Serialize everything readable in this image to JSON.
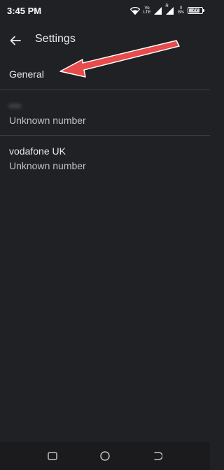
{
  "status_bar": {
    "time": "3:45 PM",
    "volte_label_top": "Vo",
    "volte_label_bottom": "LTE",
    "signal_r_label": "R",
    "data_rate_top": "0",
    "data_rate_bottom": "B/s",
    "battery_level": "77",
    "icons": [
      "wifi-icon",
      "volte-icon",
      "signal-icon",
      "signal-icon",
      "data-rate",
      "battery-icon"
    ]
  },
  "app_bar": {
    "title": "Settings",
    "back_icon": "arrow-left-icon"
  },
  "list": {
    "general": {
      "label": "General"
    },
    "sims": [
      {
        "name": "•••",
        "subtitle": "Unknown number"
      },
      {
        "name": "vodafone UK",
        "subtitle": "Unknown number"
      }
    ]
  },
  "annotation": {
    "arrow_color": "#e84b4b"
  },
  "nav_bar": {
    "icons": [
      "recents-icon",
      "home-icon",
      "back-nav-icon"
    ]
  }
}
